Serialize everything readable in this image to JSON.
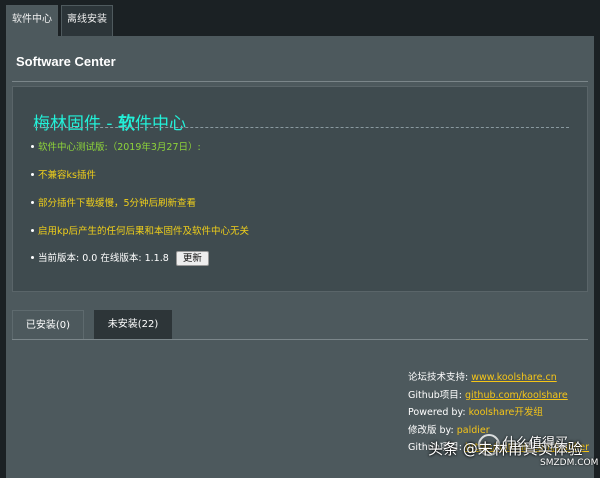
{
  "tabs": [
    {
      "label": "软件中心"
    },
    {
      "label": "离线安装"
    }
  ],
  "section_title": "Software Center",
  "header": {
    "part1": "梅林固件 - ",
    "part2_highlight": "软",
    "part3": "件中心"
  },
  "notes": [
    {
      "text": "软件中心测试版:（2019年3月27日）:"
    },
    {
      "text": "不兼容ks插件"
    },
    {
      "text": "部分插件下载缓慢，5分钟后刷新查看"
    },
    {
      "text": "启用kp后产生的任何后果和本固件及软件中心无关"
    }
  ],
  "version": {
    "current_label": "当前版本:",
    "current": "0.0",
    "online_label": "在线版本:",
    "online": "1.1.8",
    "update_button": "更新"
  },
  "bottom_tabs": [
    {
      "label": "已安装(0)"
    },
    {
      "label": "未安装(22)"
    }
  ],
  "footer": {
    "forum_label": "论坛技术支持:",
    "forum_link": "www.koolshare.cn",
    "github_label": "Github项目:",
    "github_link": "github.com/koolshare",
    "powered_label": "Powered by:",
    "powered_value": "koolshare开发组",
    "modified_label": "修改版 by:",
    "modified_value": "paldier",
    "github2_label": "Github项目:",
    "github2_link": "https://github.com/paldier"
  },
  "watermark": {
    "text": "头条 @未林甫真实体验",
    "sub": "SMZDM.COM",
    "overlay": "什么值得买"
  }
}
